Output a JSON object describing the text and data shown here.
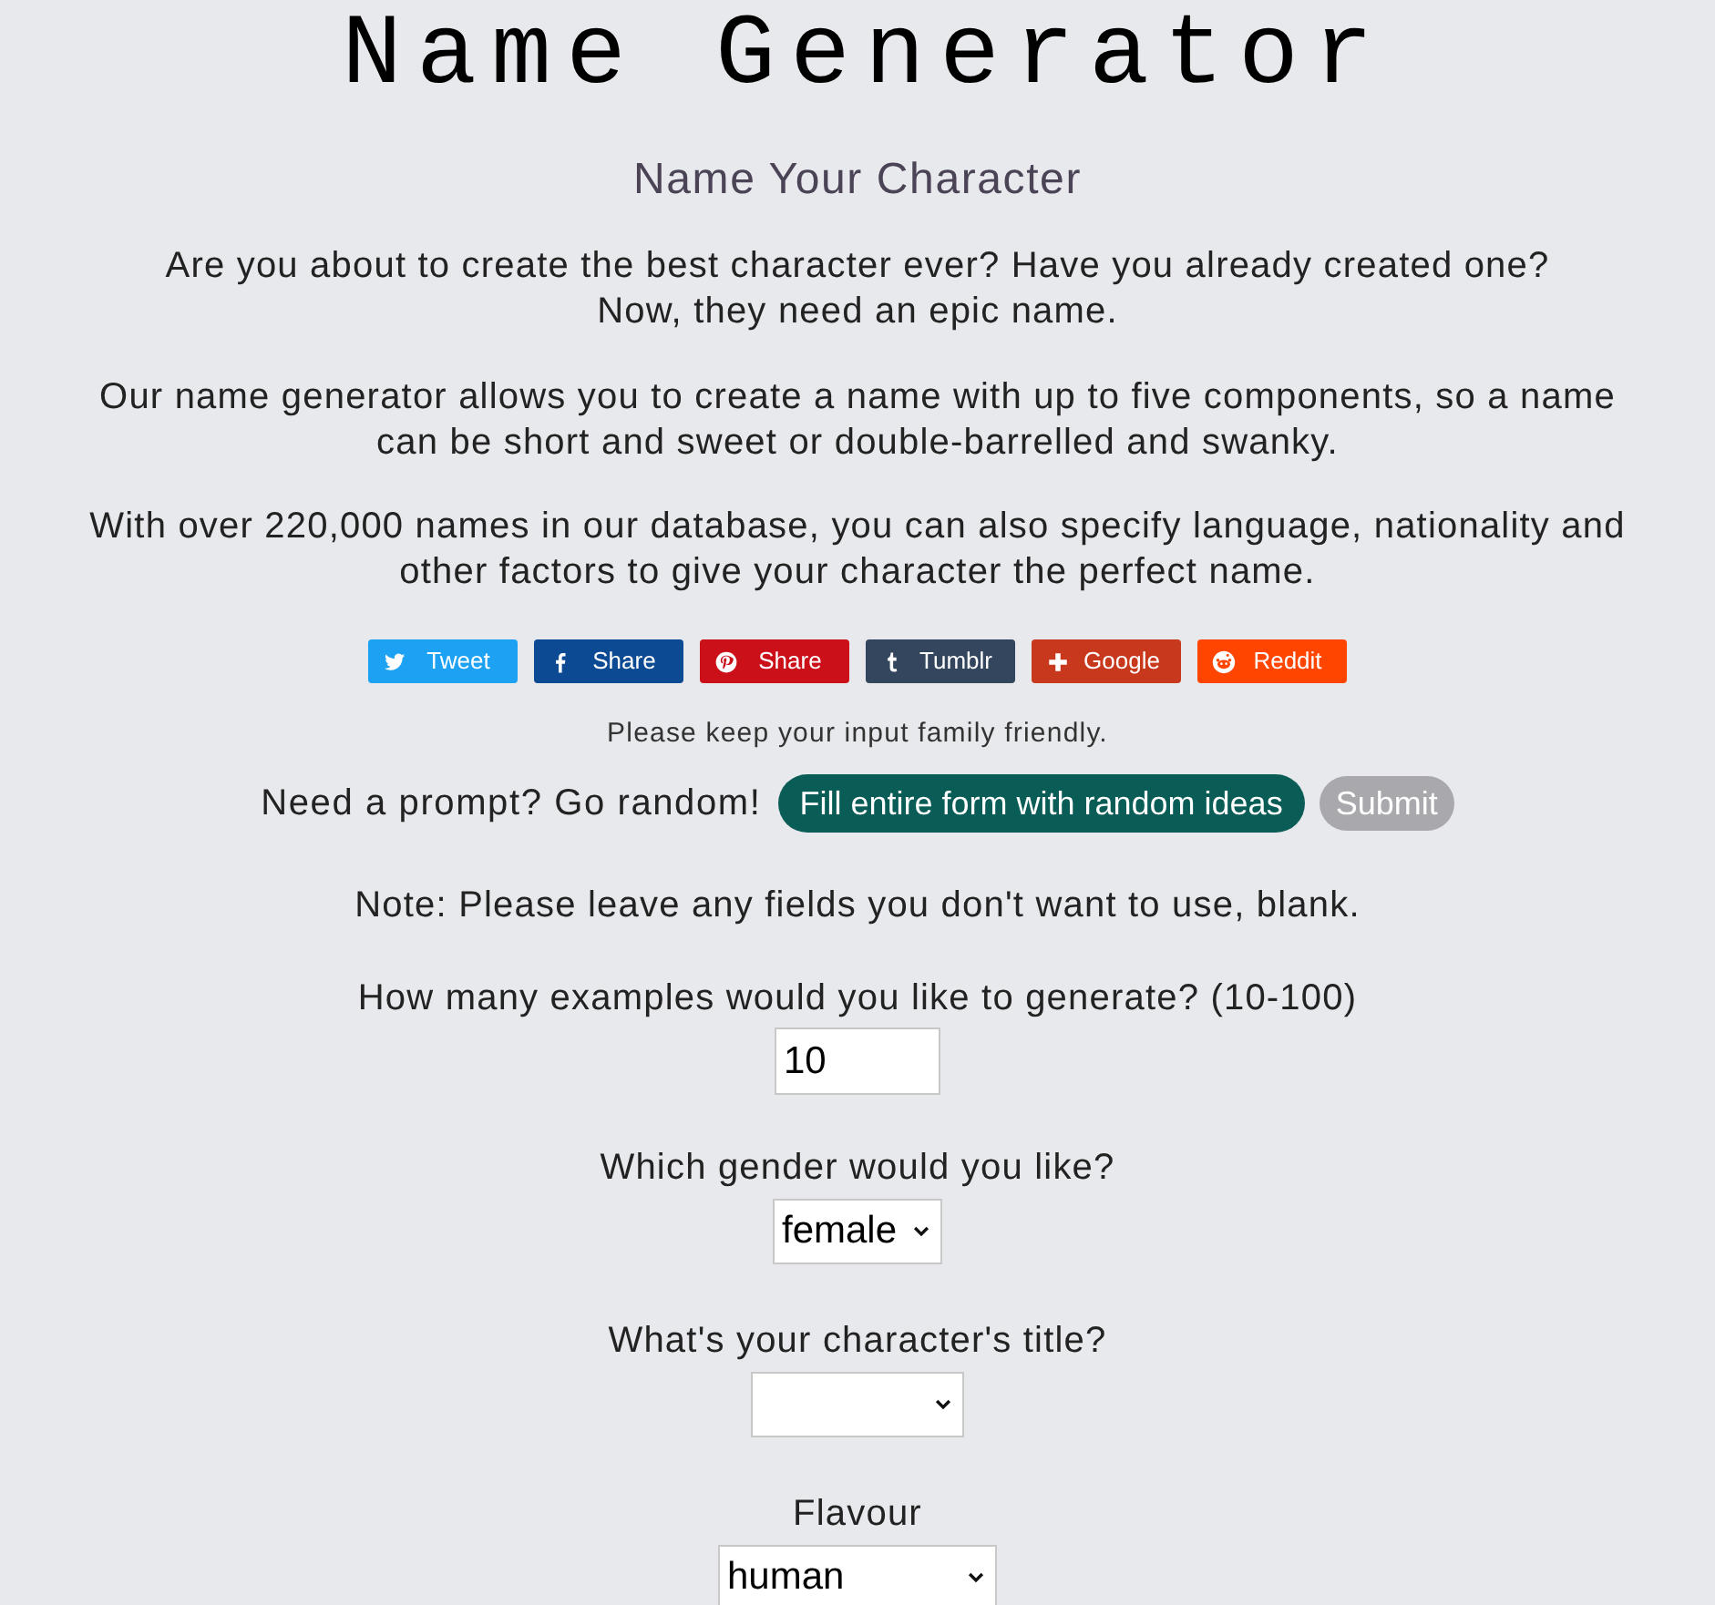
{
  "header": {
    "title": "Name Generator",
    "subtitle": "Name Your Character"
  },
  "intro": [
    "Are you about to create the best character ever? Have you already created one? Now, they need an epic name.",
    "Our name generator allows you to create a name with up to five components, so a name can be short and sweet or double-barrelled and swanky.",
    "With over 220,000 names in our database, you can also specify language, nationality and other factors to give your character the perfect name."
  ],
  "share_buttons": [
    {
      "kind": "twitter",
      "label": "Tweet",
      "color": "#1da1f2"
    },
    {
      "kind": "facebook",
      "label": "Share",
      "color": "#0d4a94"
    },
    {
      "kind": "pinterest",
      "label": "Share",
      "color": "#cb1019"
    },
    {
      "kind": "tumblr",
      "label": "Tumblr",
      "color": "#34465d"
    },
    {
      "kind": "google",
      "label": "Google",
      "color": "#c8381c"
    },
    {
      "kind": "reddit",
      "label": "Reddit",
      "color": "#ff4500"
    }
  ],
  "notice": "Please keep your input family friendly.",
  "random_row": {
    "prompt": "Need a prompt? Go random!",
    "random_button": "Fill entire form with random ideas",
    "submit": {
      "label": "Submit",
      "disabled": true
    }
  },
  "note": "Note: Please leave any fields you don't want to use, blank.",
  "fields": [
    {
      "kind": "number",
      "label": "How many examples would you like to generate? (10-100)",
      "value": "10"
    },
    {
      "kind": "select",
      "label": "Which gender would you like?",
      "value": "female"
    },
    {
      "kind": "select",
      "label": "What's your character's title?"
    },
    {
      "kind": "select",
      "label": "Flavour",
      "value": "human"
    }
  ]
}
